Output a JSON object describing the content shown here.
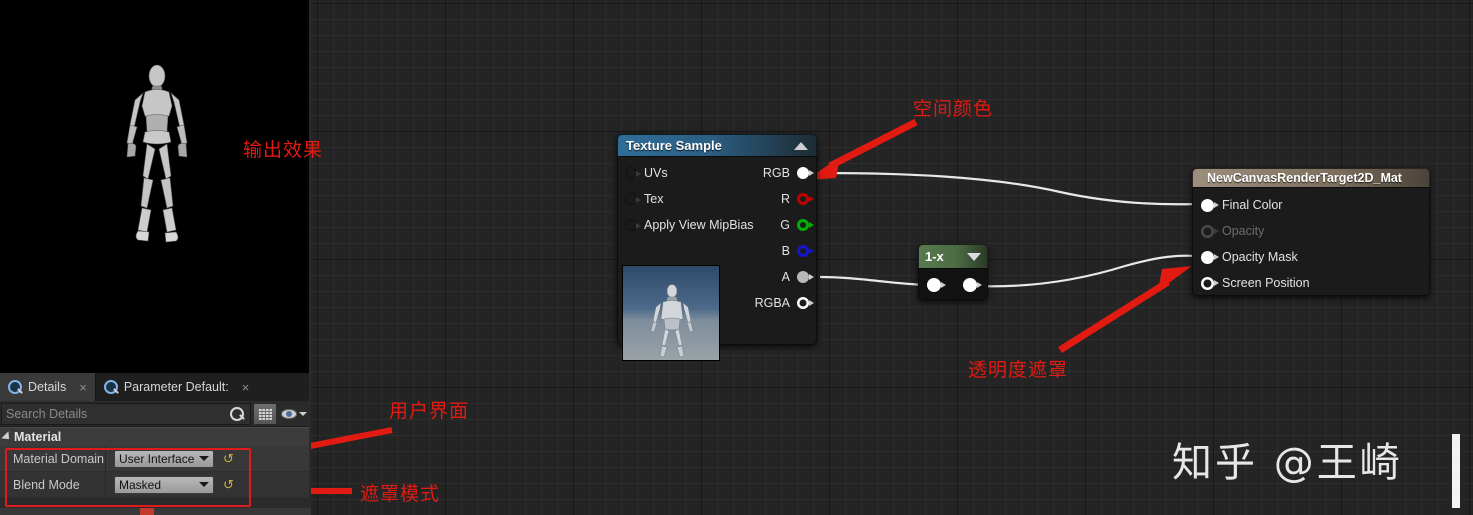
{
  "viewport": {
    "name": "material-preview-viewport",
    "content_description": "3D mannequin preview"
  },
  "details_panel": {
    "tabs": [
      {
        "label": "Details",
        "icon": "magnifier-icon",
        "active": true,
        "close": "×"
      },
      {
        "label": "Parameter Default:",
        "icon": "magnifier-icon",
        "active": false,
        "close": "×"
      }
    ],
    "search": {
      "placeholder": "Search Details",
      "value": "",
      "icon": "search-icon"
    },
    "toolbar": {
      "grid_icon": "grid-view-icon",
      "eye_icon": "visibility-eye-icon",
      "caret_icon": "chevron-down-icon"
    },
    "category": {
      "title": "Material",
      "expander": "triangle-down-icon"
    },
    "properties": [
      {
        "label": "Material Domain",
        "value": "User Interface",
        "reset": "↺",
        "arrow": "chevron-down-icon"
      },
      {
        "label": "Blend Mode",
        "value": "Masked",
        "reset": "↺",
        "arrow": "chevron-down-icon"
      }
    ]
  },
  "graph": {
    "nodes": [
      {
        "id": "texture-sample",
        "title": "Texture Sample",
        "header_icon": "collapse-triangle-icon",
        "inputs": [
          {
            "label": "UVs"
          },
          {
            "label": "Tex"
          },
          {
            "label": "Apply View MipBias"
          }
        ],
        "outputs": [
          {
            "label": "RGB",
            "color": "#ffffff"
          },
          {
            "label": "R",
            "color": "#c00000"
          },
          {
            "label": "G",
            "color": "#00b000"
          },
          {
            "label": "B",
            "color": "#1414cc"
          },
          {
            "label": "A",
            "color": "#b9b9b9"
          },
          {
            "label": "RGBA",
            "color": "#ffffff"
          }
        ],
        "thumbnail": "texture-preview-thumbnail"
      },
      {
        "id": "one-minus-x",
        "title": "1-x",
        "header_icon": "chevron-down-icon",
        "inputs": [
          {
            "label": ""
          }
        ],
        "outputs": [
          {
            "label": ""
          }
        ]
      },
      {
        "id": "material-output",
        "title": "NewCanvasRenderTarget2D_Mat",
        "inputs": [
          {
            "label": "Final Color",
            "connected": true,
            "enabled": true
          },
          {
            "label": "Opacity",
            "connected": false,
            "enabled": false
          },
          {
            "label": "Opacity Mask",
            "connected": true,
            "enabled": true
          },
          {
            "label": "Screen Position",
            "connected": false,
            "enabled": true
          }
        ]
      }
    ]
  },
  "annotations": [
    {
      "id": "anno-output-effect",
      "text": "输出效果"
    },
    {
      "id": "anno-space-color",
      "text": "空间颜色"
    },
    {
      "id": "anno-opacity-mask",
      "text": "透明度遮罩"
    },
    {
      "id": "anno-user-interface",
      "text": "用户界面"
    },
    {
      "id": "anno-mask-mode",
      "text": "遮罩模式"
    }
  ],
  "watermark": {
    "text": "知乎 @王崎"
  },
  "colors": {
    "annotation_red": "#e21b12",
    "highlight_box": "#e01b1b",
    "node_blue": "#2f6d98",
    "node_green": "#587a4d",
    "node_tan": "#9d8f7d",
    "wire_white": "#e8e8e8"
  }
}
